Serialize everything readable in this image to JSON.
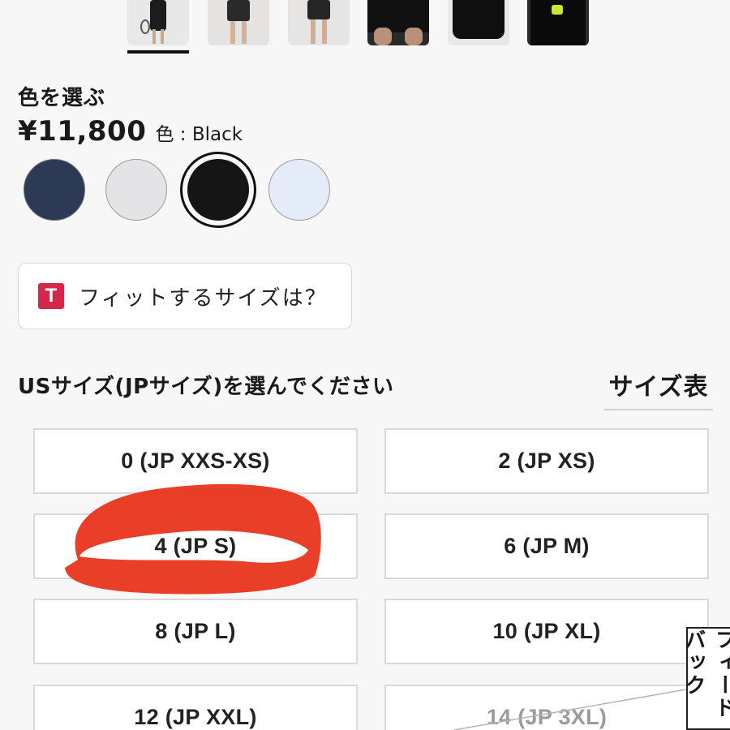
{
  "thumbnails": [
    {
      "name": "thumb-1",
      "selected": true,
      "bg": "#e8e8e8",
      "fig": "#1c1c1c"
    },
    {
      "name": "thumb-2",
      "selected": false,
      "bg": "#e4e3e1",
      "fig": "#2a2a2a"
    },
    {
      "name": "thumb-3",
      "selected": false,
      "bg": "#e6e5e3",
      "fig": "#262626"
    },
    {
      "name": "thumb-4",
      "selected": false,
      "bg": "#2a2a2a",
      "fig": "#0c0c0c"
    },
    {
      "name": "thumb-5",
      "selected": false,
      "bg": "#e8e8e8",
      "fig": "#0f0f0f"
    },
    {
      "name": "thumb-6",
      "selected": false,
      "bg": "#2b2b2b",
      "fig": "#0a0a0a"
    }
  ],
  "color_section": {
    "heading": "色を選ぶ",
    "price": "¥11,800",
    "color_label": "色 :",
    "color_value": " Black",
    "swatches": [
      {
        "name": "swatch-navy",
        "color": "#2c3a55",
        "selected": false
      },
      {
        "name": "swatch-light-gray",
        "color": "#e4e4e6",
        "selected": false
      },
      {
        "name": "swatch-black",
        "color": "#151515",
        "selected": true
      },
      {
        "name": "swatch-light-blue",
        "color": "#e4ecfa",
        "selected": false
      }
    ]
  },
  "fit": {
    "logo": "T",
    "label": "フィットするサイズは？"
  },
  "size_section": {
    "heading": "USサイズ(JPサイズ)を選んでください",
    "chart_link": "サイズ表",
    "sizes": [
      {
        "label": "0 (JP XXS-XS)",
        "disabled": false
      },
      {
        "label": "2 (JP XS)",
        "disabled": false
      },
      {
        "label": "4 (JP S)",
        "disabled": false
      },
      {
        "label": "6 (JP M)",
        "disabled": false
      },
      {
        "label": "8 (JP L)",
        "disabled": false
      },
      {
        "label": "10 (JP XL)",
        "disabled": false
      },
      {
        "label": "12 (JP XXL)",
        "disabled": false
      },
      {
        "label": "14 (JP 3XL)",
        "disabled": true
      }
    ]
  },
  "feedback_tab": "フィードバック",
  "annotation_color": "#e8341c"
}
